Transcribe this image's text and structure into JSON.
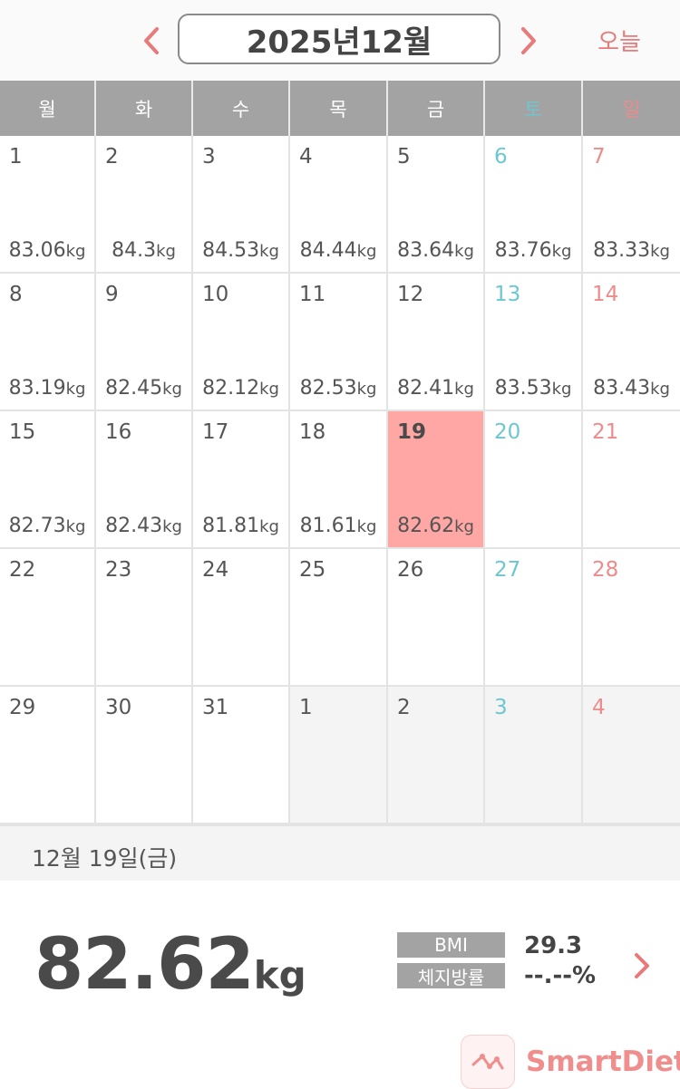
{
  "header": {
    "month_title": "2025년12월",
    "today_label": "오늘"
  },
  "weekdays": [
    "월",
    "화",
    "수",
    "목",
    "금",
    "토",
    "일"
  ],
  "calendar": {
    "unit": "kg",
    "weeks": [
      [
        {
          "day": "1",
          "weight": "83.06"
        },
        {
          "day": "2",
          "weight": "84.3"
        },
        {
          "day": "3",
          "weight": "84.53"
        },
        {
          "day": "4",
          "weight": "84.44"
        },
        {
          "day": "5",
          "weight": "83.64"
        },
        {
          "day": "6",
          "weight": "83.76"
        },
        {
          "day": "7",
          "weight": "83.33"
        }
      ],
      [
        {
          "day": "8",
          "weight": "83.19"
        },
        {
          "day": "9",
          "weight": "82.45"
        },
        {
          "day": "10",
          "weight": "82.12"
        },
        {
          "day": "11",
          "weight": "82.53"
        },
        {
          "day": "12",
          "weight": "82.41"
        },
        {
          "day": "13",
          "weight": "83.53"
        },
        {
          "day": "14",
          "weight": "83.43"
        }
      ],
      [
        {
          "day": "15",
          "weight": "82.73"
        },
        {
          "day": "16",
          "weight": "82.43"
        },
        {
          "day": "17",
          "weight": "81.81"
        },
        {
          "day": "18",
          "weight": "81.61"
        },
        {
          "day": "19",
          "weight": "82.62",
          "selected": true
        },
        {
          "day": "20"
        },
        {
          "day": "21"
        }
      ],
      [
        {
          "day": "22"
        },
        {
          "day": "23"
        },
        {
          "day": "24"
        },
        {
          "day": "25"
        },
        {
          "day": "26"
        },
        {
          "day": "27"
        },
        {
          "day": "28"
        }
      ],
      [
        {
          "day": "29"
        },
        {
          "day": "30"
        },
        {
          "day": "31"
        },
        {
          "day": "1",
          "other": true
        },
        {
          "day": "2",
          "other": true
        },
        {
          "day": "3",
          "other": true
        },
        {
          "day": "4",
          "other": true
        }
      ]
    ]
  },
  "selected": {
    "date_label": "12월 19일(금)",
    "weight": "82.62",
    "unit": "kg",
    "bmi_label": "BMI",
    "bmi_value": "29.3",
    "fat_label": "체지방률",
    "fat_value": "--.--%"
  },
  "brand": {
    "name": "SmartDiet"
  },
  "colors": {
    "accent": "#e77a7a",
    "selected_bg": "#ffa7a4",
    "saturday": "#6cc7d0",
    "sunday": "#ee8b8b",
    "header_gray": "#a3a3a3"
  }
}
